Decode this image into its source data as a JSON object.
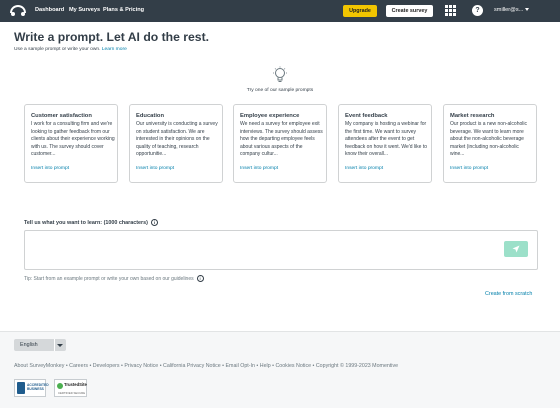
{
  "nav": {
    "links": [
      "Dashboard",
      "My Surveys",
      "Plans & Pricing"
    ],
    "upgrade_label": "Upgrade",
    "create_label": "Create survey",
    "help_symbol": "?",
    "user": "smiller@s...",
    "icons": [
      "surveymonkey-logo-icon",
      "apps-grid-icon",
      "help-icon",
      "chevron-down-icon"
    ]
  },
  "header": {
    "title": "Write a prompt. Let AI do the rest.",
    "subtitle_text": "Use a sample prompt or write your own.",
    "subtitle_link": "Learn more"
  },
  "samples": {
    "hint": "Try one of our sample prompts",
    "cards": [
      {
        "title": "Customer satisfaction",
        "text": "I work for a consulting firm and we're looking to gather feedback from our clients about their experience working with us. The survey should cover customer...",
        "link": "Insert into prompt"
      },
      {
        "title": "Education",
        "text": "Our university is conducting a survey on student satisfaction. We are interested in their opinions on the quality of teaching, research opportunitie...",
        "link": "Insert into prompt"
      },
      {
        "title": "Employee experience",
        "text": "We need a survey for employee exit interviews. The survey should assess how the departing employee feels about various aspects of the company cultur...",
        "link": "Insert into prompt"
      },
      {
        "title": "Event feedback",
        "text": "My company is hosting a webinar for the first time. We want to survey attendees after the event to get feedback on how it went. We'd like to know their overall...",
        "link": "Insert into prompt"
      },
      {
        "title": "Market research",
        "text": "Our product is a new non-alcoholic beverage. We want to learn more about the non-alcoholic beverage market (including non-alcoholic wine...",
        "link": "Insert into prompt"
      }
    ]
  },
  "prompt": {
    "label": "Tell us what you want to learn: (1000 characters)",
    "value": "",
    "tip": "Tip: Start from an example prompt or write your own based on our guidelines",
    "create_from_scratch": "Create from scratch"
  },
  "footer": {
    "language": "English",
    "links": "About SurveyMonkey • Careers • Developers • Privacy Notice • California Privacy Notice • Email Opt-In • Help • Cookies Notice • Copyright © 1999-2023 Momentive",
    "bbb_text": "ACCREDITED BUSINESS",
    "trust_title": "TrustedSite",
    "trust_sub": "CERTIFIED SECURE"
  },
  "colors": {
    "nav_bg": "#333e48",
    "upgrade_bg": "#f2c500",
    "link": "#007faa",
    "send_button": "#9ce0c9"
  }
}
